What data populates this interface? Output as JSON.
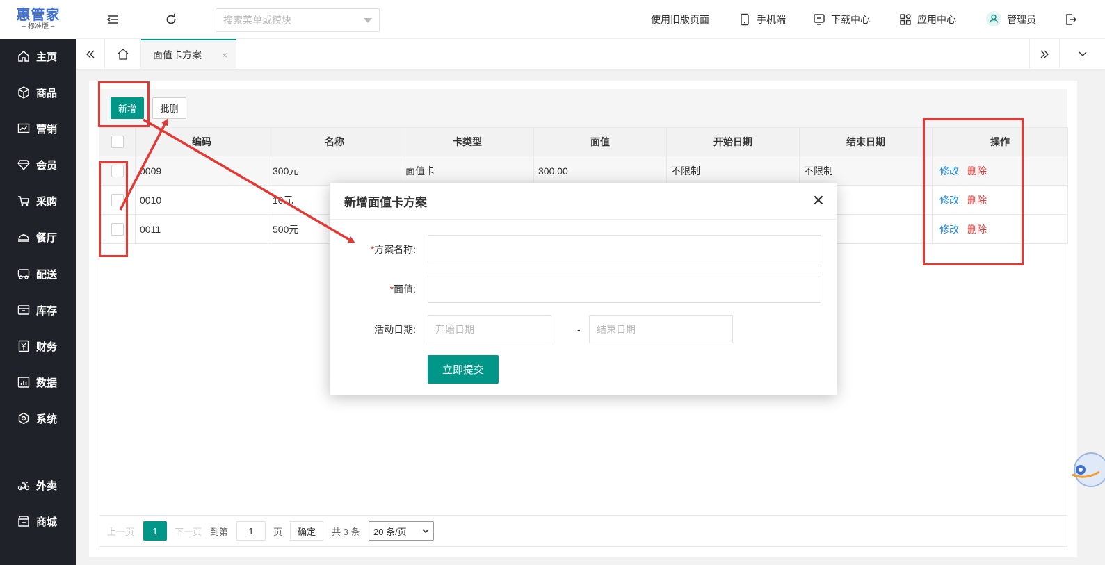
{
  "app": {
    "logo_title": "惠管家",
    "logo_sub": "– 标准版 –"
  },
  "sidebar": {
    "items": [
      {
        "label": "主页",
        "icon": "home-icon"
      },
      {
        "label": "商品",
        "icon": "cube-icon"
      },
      {
        "label": "营销",
        "icon": "chart-icon"
      },
      {
        "label": "会员",
        "icon": "diamond-icon"
      },
      {
        "label": "采购",
        "icon": "cart-icon"
      },
      {
        "label": "餐厅",
        "icon": "dome-icon"
      },
      {
        "label": "配送",
        "icon": "truck-icon"
      },
      {
        "label": "库存",
        "icon": "box-icon"
      },
      {
        "label": "财务",
        "icon": "yen-icon"
      },
      {
        "label": "数据",
        "icon": "bar-chart-icon"
      },
      {
        "label": "系统",
        "icon": "settings-icon"
      },
      {
        "label": "外卖",
        "icon": "scooter-icon"
      },
      {
        "label": "商城",
        "icon": "store-icon"
      }
    ]
  },
  "header": {
    "search_placeholder": "搜索菜单或模块",
    "old_page": "使用旧版页面",
    "mobile": "手机端",
    "download": "下载中心",
    "apps": "应用中心",
    "user": "管理员"
  },
  "tabs": {
    "active": "面值卡方案",
    "close": "×"
  },
  "toolbar": {
    "add": "新增",
    "batch_delete": "批删"
  },
  "table": {
    "columns": [
      "编码",
      "名称",
      "卡类型",
      "面值",
      "开始日期",
      "结束日期",
      "操作"
    ],
    "rows": [
      {
        "code": "0009",
        "name": "300元",
        "type": "面值卡",
        "value": "300.00",
        "start": "不限制",
        "end": "不限制"
      },
      {
        "code": "0010",
        "name": "10元",
        "type": "",
        "value": "",
        "start": "",
        "end": ""
      },
      {
        "code": "0011",
        "name": "500元",
        "type": "",
        "value": "",
        "start": "",
        "end": ""
      }
    ],
    "edit_label": "修改",
    "delete_label": "删除"
  },
  "pager": {
    "prev": "上一页",
    "current": "1",
    "next": "下一页",
    "goto": "到第",
    "input_value": "1",
    "page_unit": "页",
    "confirm": "确定",
    "total": "共 3 条",
    "page_size": "20 条/页"
  },
  "modal": {
    "title": "新增面值卡方案",
    "close": "✕",
    "required_mark": "*",
    "name_label": "方案名称:",
    "value_label": "面值:",
    "date_label": "活动日期:",
    "start_placeholder": "开始日期",
    "date_sep": "-",
    "end_placeholder": "结束日期",
    "submit": "立即提交"
  },
  "colors": {
    "primary": "#009688",
    "sidebar": "#20222a",
    "annotation": "#e53935",
    "link": "#1e88e5",
    "danger": "#e53935"
  }
}
